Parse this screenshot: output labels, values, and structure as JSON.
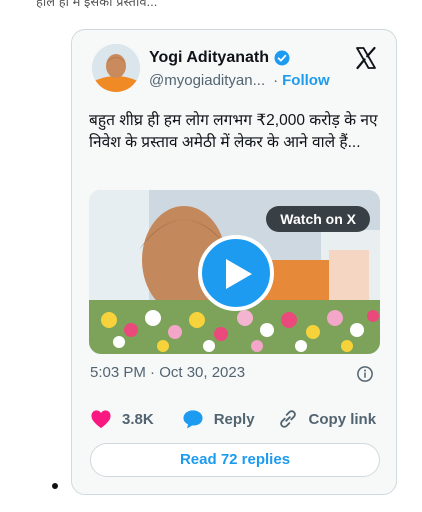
{
  "page": {
    "top_text": "हाल ही में इसका प्रस्ताव...",
    "bullet": "•"
  },
  "tweet": {
    "author_name": "Yogi Adityanath",
    "handle": "@myogiadityan...",
    "separator": "·",
    "follow_label": "Follow",
    "text": "बहुत शीघ्र ही हम लोग लगभग ₹2,000 करोड़ के नए निवेश के प्रस्ताव अमेठी में लेकर के आने वाले हैं...",
    "timestamp": "5:03 PM · Oct 30, 2023",
    "media": {
      "watch_label": "Watch on X"
    },
    "actions": {
      "likes": "3.8K",
      "reply_label": "Reply",
      "copy_label": "Copy link"
    },
    "read_replies_label": "Read 72 replies"
  },
  "colors": {
    "accent": "#1d9bf0",
    "like_heart": "#f91880",
    "card_bg": "#f7f9f9",
    "border": "#cfd9de",
    "muted_text": "#536471"
  },
  "icons": [
    "verified-badge-icon",
    "x-logo-icon",
    "play-icon",
    "info-icon",
    "heart-icon",
    "reply-bubble-icon",
    "link-icon"
  ]
}
